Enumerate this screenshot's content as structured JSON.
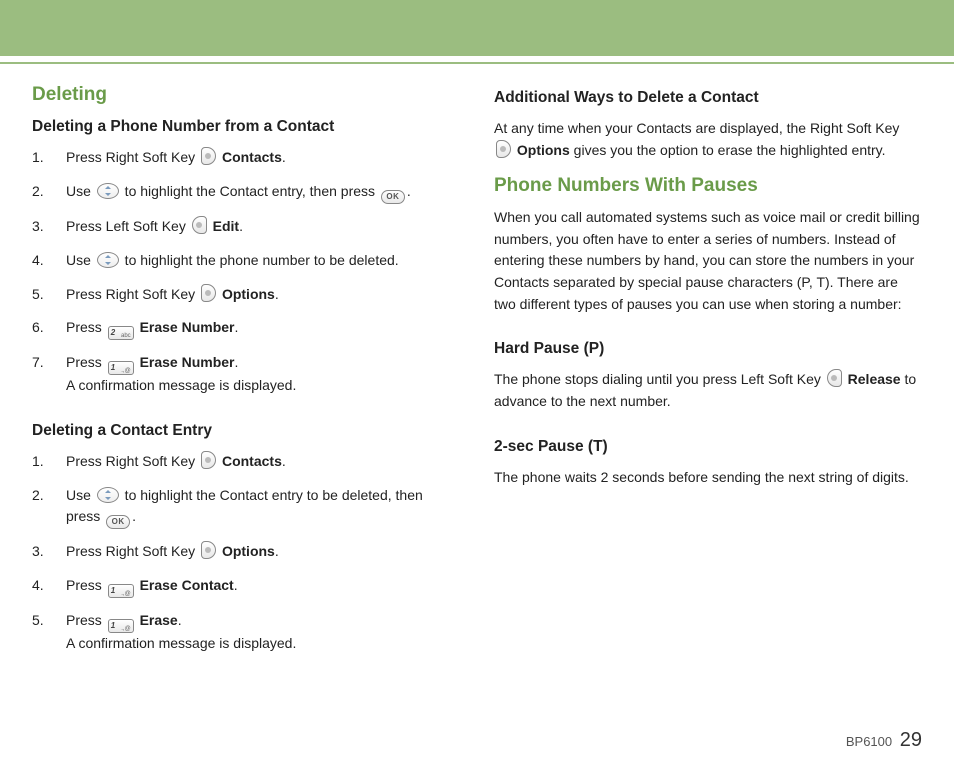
{
  "left": {
    "h_deleting": "Deleting",
    "h_del_phone": "Deleting a Phone Number from a Contact",
    "steps_phone": [
      {
        "n": "1.",
        "pre": "Press Right Soft Key ",
        "icon": "right-soft",
        "post": " ",
        "bold": "Contacts",
        "tail": "."
      },
      {
        "n": "2.",
        "pre": "Use ",
        "icon": "nav",
        "post": " to highlight the Contact entry, then press ",
        "icon2": "ok",
        "tail": "."
      },
      {
        "n": "3.",
        "pre": "Press Left Soft Key ",
        "icon": "left-soft",
        "post": "  ",
        "bold": "Edit",
        "tail": "."
      },
      {
        "n": "4.",
        "pre": "Use ",
        "icon": "nav",
        "post": " to highlight the phone number to be deleted."
      },
      {
        "n": "5.",
        "pre": "Press Right Soft Key ",
        "icon": "right-soft",
        "post": " ",
        "bold": "Options",
        "tail": "."
      },
      {
        "n": "6.",
        "pre": "Press ",
        "icon": "key2",
        "post": " ",
        "bold": "Erase Number",
        "tail": "."
      },
      {
        "n": "7.",
        "pre": "Press ",
        "icon": "key1",
        "post": " ",
        "bold": "Erase Number",
        "tail": ".",
        "note": "A confirmation message is displayed."
      }
    ],
    "h_del_contact": "Deleting a Contact Entry",
    "steps_contact": [
      {
        "n": "1.",
        "pre": "Press Right Soft Key ",
        "icon": "right-soft",
        "post": " ",
        "bold": "Contacts",
        "tail": "."
      },
      {
        "n": "2.",
        "pre": "Use ",
        "icon": "nav",
        "post": " to highlight the Contact entry to be deleted, then press ",
        "icon2": "ok",
        "tail": "."
      },
      {
        "n": "3.",
        "pre": "Press Right Soft Key ",
        "icon": "right-soft",
        "post": " ",
        "bold": "Options",
        "tail": "."
      },
      {
        "n": "4.",
        "pre": "Press ",
        "icon": "key1",
        "post": " ",
        "bold": "Erase Contact",
        "tail": "."
      },
      {
        "n": "5.",
        "pre": "Press ",
        "icon": "key1",
        "post": " ",
        "bold": "Erase",
        "tail": ".",
        "note": "A confirmation message is displayed."
      }
    ]
  },
  "right": {
    "h_additional": "Additional Ways to Delete a Contact",
    "p_additional_pre": "At any time when your Contacts are displayed, the Right Soft Key ",
    "p_additional_bold": "Options",
    "p_additional_post": " gives you the option to erase the highlighted entry.",
    "h_pauses": "Phone Numbers With Pauses",
    "p_pauses": "When you call automated systems such as voice mail or credit billing numbers, you often have to enter a series of numbers. Instead of entering these numbers by hand, you can store the numbers in your Contacts separated by special pause characters (P, T). There are two different types of pauses you can use when storing a number:",
    "h_hard": "Hard Pause (P)",
    "p_hard_pre": "The phone stops dialing until you press Left Soft Key ",
    "p_hard_bold": "Release",
    "p_hard_post": " to advance to the next number.",
    "h_2sec": "2-sec Pause (T)",
    "p_2sec": "The phone waits 2 seconds before sending the next string of digits."
  },
  "footer": {
    "model": "BP6100",
    "page": "29"
  },
  "keys": {
    "ok": "OK",
    "k1": "1",
    "k1t": ".,@",
    "k2": "2",
    "k2t": "abc"
  }
}
